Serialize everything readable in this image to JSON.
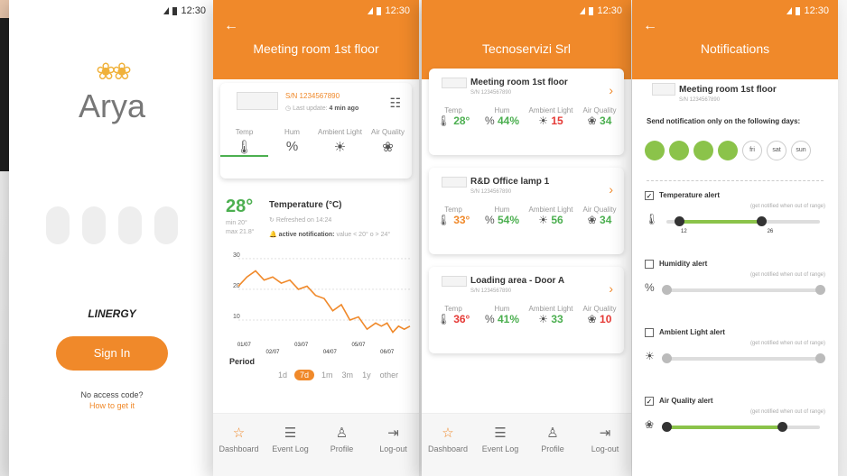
{
  "status": {
    "time": "12:30"
  },
  "login": {
    "app_name": "Arya",
    "brand": "LINERGY",
    "sign_in_label": "Sign In",
    "no_code_text": "No access code?",
    "how_to_get_link": "How to get it"
  },
  "detail": {
    "title": "Meeting room 1st floor",
    "device_sn": "S/N 1234567890",
    "last_update_label": "Last update:",
    "last_update_value": "4 min ago",
    "sensors": [
      "Temp",
      "Hum",
      "Ambient Light",
      "Air Quality"
    ],
    "temp_value": "28°",
    "temp_min": "min 20°",
    "temp_max": "max 21.8°",
    "chart_title": "Temperature (°C)",
    "refreshed": "Refreshed on 14:24",
    "active_notif_label": "active notification:",
    "active_notif_value": "value < 20° o > 24°",
    "period_label": "Period",
    "periods": [
      "1d",
      "7d",
      "1m",
      "3m",
      "1y",
      "other"
    ],
    "selected_period": "7d"
  },
  "chart_data": {
    "type": "line",
    "title": "Temperature (°C)",
    "x_ticks": [
      "01/07",
      "02/07",
      "03/07",
      "04/07",
      "05/07",
      "06/07"
    ],
    "y_ticks": [
      30,
      20,
      10
    ],
    "ylim": [
      5,
      32
    ],
    "x": [
      0,
      0.3,
      0.6,
      0.9,
      1.2,
      1.5,
      1.8,
      2.1,
      2.4,
      2.7,
      3.0,
      3.3,
      3.6,
      3.9,
      4.2,
      4.5,
      4.8,
      5.0,
      5.2,
      5.4,
      5.6,
      5.8,
      6.0
    ],
    "values": [
      21,
      24,
      26,
      23,
      24,
      22,
      23,
      20,
      21,
      18,
      17,
      13,
      15,
      10,
      11,
      7,
      9,
      8,
      9,
      6,
      8,
      7,
      8
    ],
    "color": "#f0892a"
  },
  "devices": {
    "title": "Tecnoservizi Srl",
    "sensor_labels": [
      "Temp",
      "Hum",
      "Ambient Light",
      "Air Quality"
    ],
    "items": [
      {
        "name": "Meeting room 1st floor",
        "sn": "S/N 1234567890",
        "temp": "28°",
        "hum": "44%",
        "light": "15",
        "air": "34"
      },
      {
        "name": "R&D Office lamp 1",
        "sn": "S/N 1234567890",
        "temp": "33°",
        "hum": "54%",
        "light": "56",
        "air": "34"
      },
      {
        "name": "Loading area - Door A",
        "sn": "S/N 1234567890",
        "temp": "36°",
        "hum": "41%",
        "light": "33",
        "air": "10"
      }
    ]
  },
  "nav": {
    "dashboard": "Dashboard",
    "event_log": "Event Log",
    "profile": "Profile",
    "logout": "Log-out"
  },
  "notifications": {
    "title": "Notifications",
    "device": "Meeting room 1st floor",
    "device_sn": "S/N 1234567890",
    "days_label": "Send notification only on the following days:",
    "days_unlabeled": [
      "",
      "",
      "",
      ""
    ],
    "days_labeled": [
      "fri",
      "sat",
      "sun"
    ],
    "hint": "(get notified when out of range)",
    "alerts": [
      {
        "label": "Temperature alert",
        "checked": true,
        "min": "12",
        "max": "26",
        "lo": 0.08,
        "hi": 0.62
      },
      {
        "label": "Humidity alert",
        "checked": false,
        "lo": 0.0,
        "hi": 1.0
      },
      {
        "label": "Ambient Light alert",
        "checked": false,
        "lo": 0.0,
        "hi": 1.0
      },
      {
        "label": "Air Quality alert",
        "checked": true,
        "lo": 0.0,
        "hi": 0.75
      }
    ]
  }
}
